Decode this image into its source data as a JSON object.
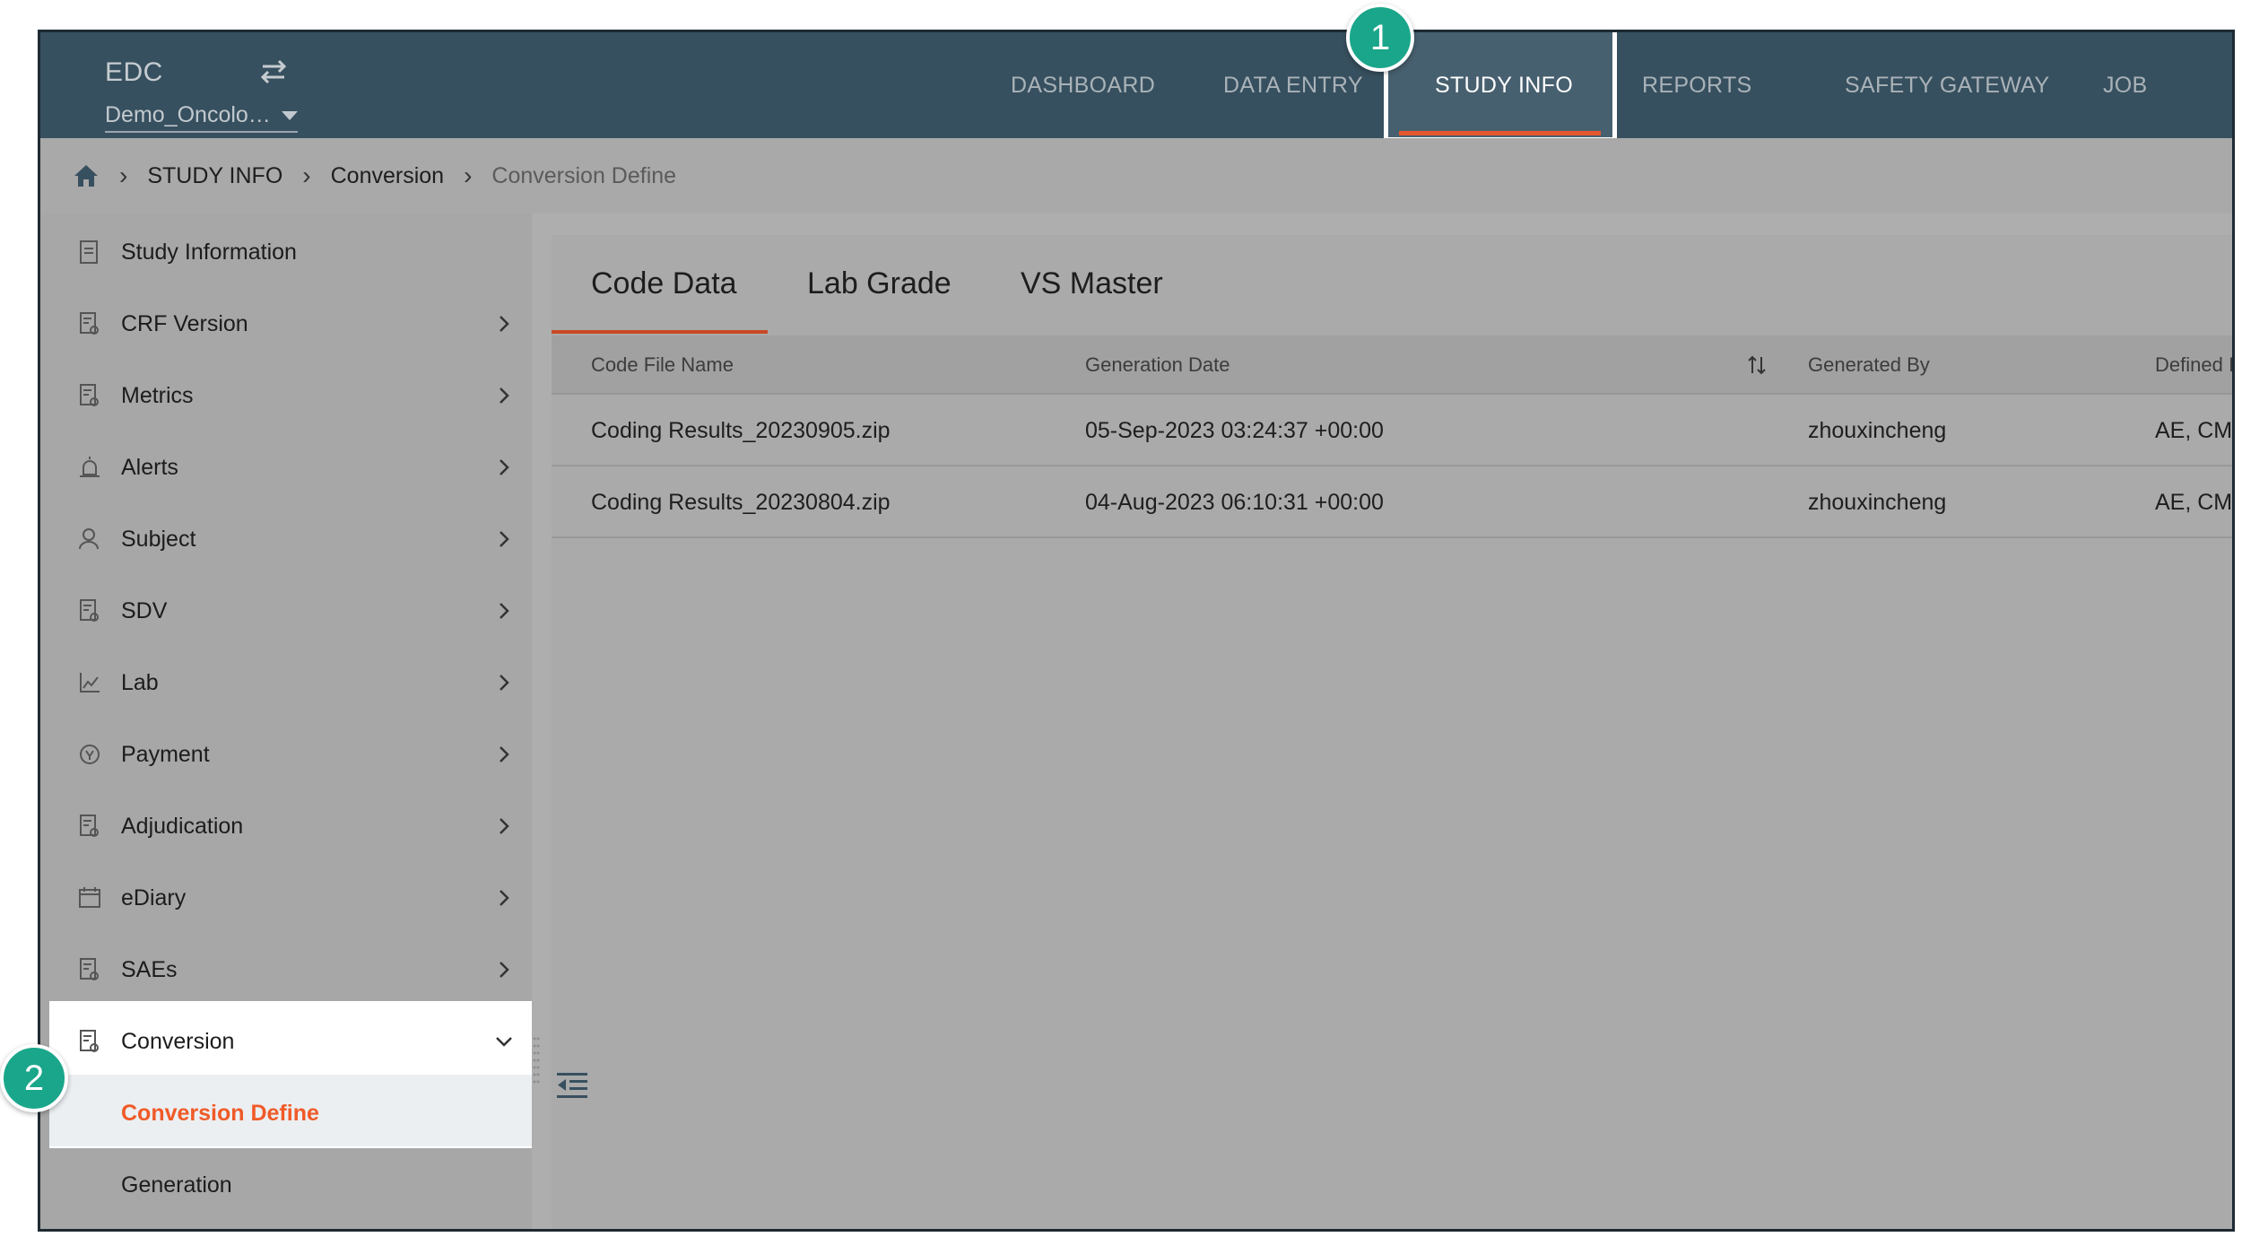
{
  "app": {
    "name": "EDC",
    "study": "Demo_Oncolo…"
  },
  "nav": {
    "items": [
      {
        "label": "DASHBOARD"
      },
      {
        "label": "DATA ENTRY"
      },
      {
        "label": "STUDY INFO",
        "active": true
      },
      {
        "label": "REPORTS"
      },
      {
        "label": "SAFETY GATEWAY"
      },
      {
        "label": "JOB"
      }
    ]
  },
  "breadcrumb": {
    "items": [
      "STUDY INFO",
      "Conversion"
    ],
    "current": "Conversion Define"
  },
  "sidebar": {
    "items": [
      {
        "label": "Study Information",
        "icon": "document-icon",
        "expandable": false
      },
      {
        "label": "CRF Version",
        "icon": "form-icon",
        "expandable": true
      },
      {
        "label": "Metrics",
        "icon": "metrics-icon",
        "expandable": true
      },
      {
        "label": "Alerts",
        "icon": "alarm-icon",
        "expandable": true
      },
      {
        "label": "Subject",
        "icon": "subject-icon",
        "expandable": true
      },
      {
        "label": "SDV",
        "icon": "sdv-icon",
        "expandable": true
      },
      {
        "label": "Lab",
        "icon": "lab-chart-icon",
        "expandable": true
      },
      {
        "label": "Payment",
        "icon": "payment-icon",
        "expandable": true
      },
      {
        "label": "Adjudication",
        "icon": "adjudication-icon",
        "expandable": true
      },
      {
        "label": "eDiary",
        "icon": "calendar-icon",
        "expandable": true
      },
      {
        "label": "SAEs",
        "icon": "sae-icon",
        "expandable": true
      },
      {
        "label": "Conversion",
        "icon": "conversion-icon",
        "expandable": true,
        "expanded": true
      }
    ],
    "subitems": [
      {
        "label": "Conversion Define",
        "selected": true
      },
      {
        "label": "Generation"
      }
    ]
  },
  "tabs": [
    {
      "label": "Code Data",
      "active": true
    },
    {
      "label": "Lab Grade"
    },
    {
      "label": "VS Master"
    }
  ],
  "table": {
    "columns": [
      "Code File Name",
      "Generation Date",
      "Generated By",
      "Defined I"
    ],
    "rows": [
      [
        "Coding Results_20230905.zip",
        "05-Sep-2023 03:24:37 +00:00",
        "zhouxincheng",
        "AE, CM, "
      ],
      [
        "Coding Results_20230804.zip",
        "04-Aug-2023 06:10:31 +00:00",
        "zhouxincheng",
        "AE, CM, "
      ]
    ]
  },
  "callouts": [
    "1",
    "2"
  ],
  "colors": {
    "topbar": "#37505f",
    "accent": "#e2572d",
    "selected_text": "#f05a28",
    "callout": "#1aa68a"
  }
}
